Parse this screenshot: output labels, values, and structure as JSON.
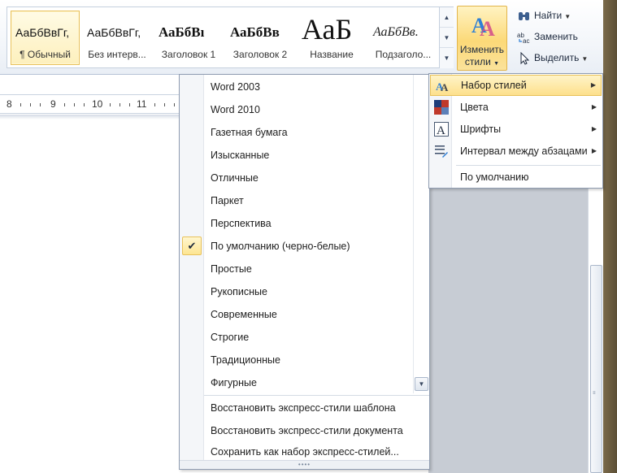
{
  "ribbon": {
    "styles_gallery": [
      {
        "sample": "АаБбВвГг,",
        "name": "¶ Обычный",
        "selected": true
      },
      {
        "sample": "АаБбВвГг,",
        "name": "Без интерв..."
      },
      {
        "sample": "АаБбВı",
        "name": "Заголовок 1"
      },
      {
        "sample": "АаБбВв",
        "name": "Заголовок 2"
      },
      {
        "sample": "АаБ",
        "name": "Название"
      },
      {
        "sample": "АаБбВв.",
        "name": "Подзаголо..."
      }
    ],
    "change_styles": {
      "line1": "Изменить",
      "line2": "стили",
      "icon": "change-styles-icon"
    },
    "editing": {
      "find": "Найти",
      "replace": "Заменить",
      "select": "Выделить"
    }
  },
  "ruler": {
    "marks": [
      "8",
      "9",
      "10",
      "11"
    ]
  },
  "style_sets_menu": {
    "items": [
      "Word 2003",
      "Word 2010",
      "Газетная бумага",
      "Изысканные",
      "Отличные",
      "Паркет",
      "Перспектива",
      "По умолчанию (черно-белые)",
      "Простые",
      "Рукописные",
      "Современные",
      "Строгие",
      "Традиционные",
      "Фигурные"
    ],
    "checked_item": "По умолчанию (черно-белые)",
    "actions": [
      "Восстановить экспресс-стили шаблона",
      "Восстановить экспресс-стили документа",
      "Сохранить как набор экспресс-стилей..."
    ]
  },
  "change_styles_menu": {
    "items": [
      {
        "label": "Набор стилей",
        "icon": "style-set-icon",
        "active": true
      },
      {
        "label": "Цвета",
        "icon": "colors-icon"
      },
      {
        "label": "Шрифты",
        "icon": "fonts-icon"
      },
      {
        "label": "Интервал между абзацами",
        "icon": "paragraph-spacing-icon"
      }
    ],
    "default_label": "По умолчанию"
  },
  "colors": {
    "highlight": "#fde08c",
    "highlight_border": "#e8c15a",
    "menu_border": "#8f9cb1"
  }
}
